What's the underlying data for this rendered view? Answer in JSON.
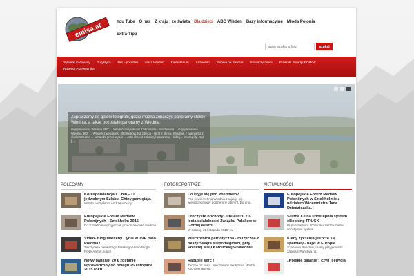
{
  "logo": {
    "text": "emisa.at"
  },
  "topnav": {
    "row1": [
      "You Tube",
      "O nas",
      "Z kraju i ze świata",
      "Dla dzieci",
      "ABC Wiedeń",
      "Bazy informacyjne",
      "Młoda Polonia"
    ],
    "row2": [
      "Extra-Tipp"
    ],
    "active_index": 3
  },
  "search": {
    "placeholder": "wpisz szukaną fraz",
    "button": "szukaj"
  },
  "redmenu": {
    "row1": [
      "Sylwetki i Wywiady",
      "Turystyka",
      "Net – poradnik",
      "Nasz Wiedeń",
      "Kalendarium",
      "Archiwum",
      "Polonia na Świecie",
      "Stowarzyszenia",
      "Prawnik/ Porady/ POMOC"
    ],
    "row2": [
      "Rubryka Przewodnika"
    ]
  },
  "slider": {
    "caption_title": "Zapraszamy do galerii fotografii, gdzie można zobaczyć panoramy stolicy Wiednia, a także pozostałe panoramy z Wiednia.",
    "caption_body": "Gigapanorama Wiednia 360° ... Wiedeń z wysokości 134 metrów - zbudowana ... Gigapanorama Wiednia 360° ... Wiedeń z wysokości 250 metrów. Na zdjęciu - skrót z okresu Wiednia, z panoramą z okolic Wiednia ... odnaleźć przez wybór ... Jeśli chcesz zobaczyć panoramę - kliknij... Szczegóły, czyli [...]",
    "dots": [
      false,
      false,
      true
    ]
  },
  "columns": [
    {
      "head": "POLECAMY",
      "items": [
        {
          "title": "Korespondencja z Chin – O jedwabnym Szlaku: Chiny pamiętają.",
          "desc": "Wizyta prezydenta Andrzeja Dudy"
        },
        {
          "title": "Europejskie Forum Mediów Polonijnych - Sztokholm 2015",
          "desc": "Do Sztokholmu przyjechali przedstawiciele mediów"
        },
        {
          "title": "Video- Blog Marceny Cybis w TVP Halo Polonia !",
          "desc": "Założyciela pierwszego Polskiego Video-Bloga POLKAart w Austrii"
        },
        {
          "title": "Nowy banknot 20 € zostanie wprowadzony do obiegu 25 listopada 2015 roku",
          "desc": ""
        }
      ]
    },
    {
      "head": "FOTOREPORTAŻE",
      "items": [
        {
          "title": "Co kryje się pod Wiedniem?",
          "desc": "Pod powierzchnią Wiednia znajduje się wielopoziomowy podziemny labirynt. Do dnia"
        },
        {
          "title": "Uroczyste obchody Jubileuszu 70-lecia działalności Związku Polaków w Górnej Austrii.",
          "desc": "W sobotę, 21 listopada 2015r. w"
        },
        {
          "title": "Wieczornica patriotyczna - muzyczna z okazji Święta Niepodległości, przy Polskiej Misji Katolickiej w Wiedniu",
          "desc": ""
        },
        {
          "title": "Rabusie serc !",
          "desc": "Zacznę od kolca. ale czasami tak trzeba. Wiehli Klich jest artystą"
        }
      ]
    },
    {
      "head": "AKTUALNOŚCI",
      "items": [
        {
          "title": "Europejskie Forum Mediów Polonijnych w Sztokholmie z udziałem Wicemnistra Jana Dziedziczaka.",
          "desc": ""
        },
        {
          "title": "Służba Celna udostępnia system eBooking TRUCK",
          "desc": "W październiku 2015 roku Służba Celna udostępnia system"
        },
        {
          "title": "Kiedy życzenia jeszcze się spełniały - bajki w Europie.",
          "desc": "Szanowni Państwo, mamy przyjemność zaprosić Państwa na"
        },
        {
          "title": "„Polskie bajanie”, czyli II edycja",
          "desc": ""
        }
      ]
    }
  ]
}
